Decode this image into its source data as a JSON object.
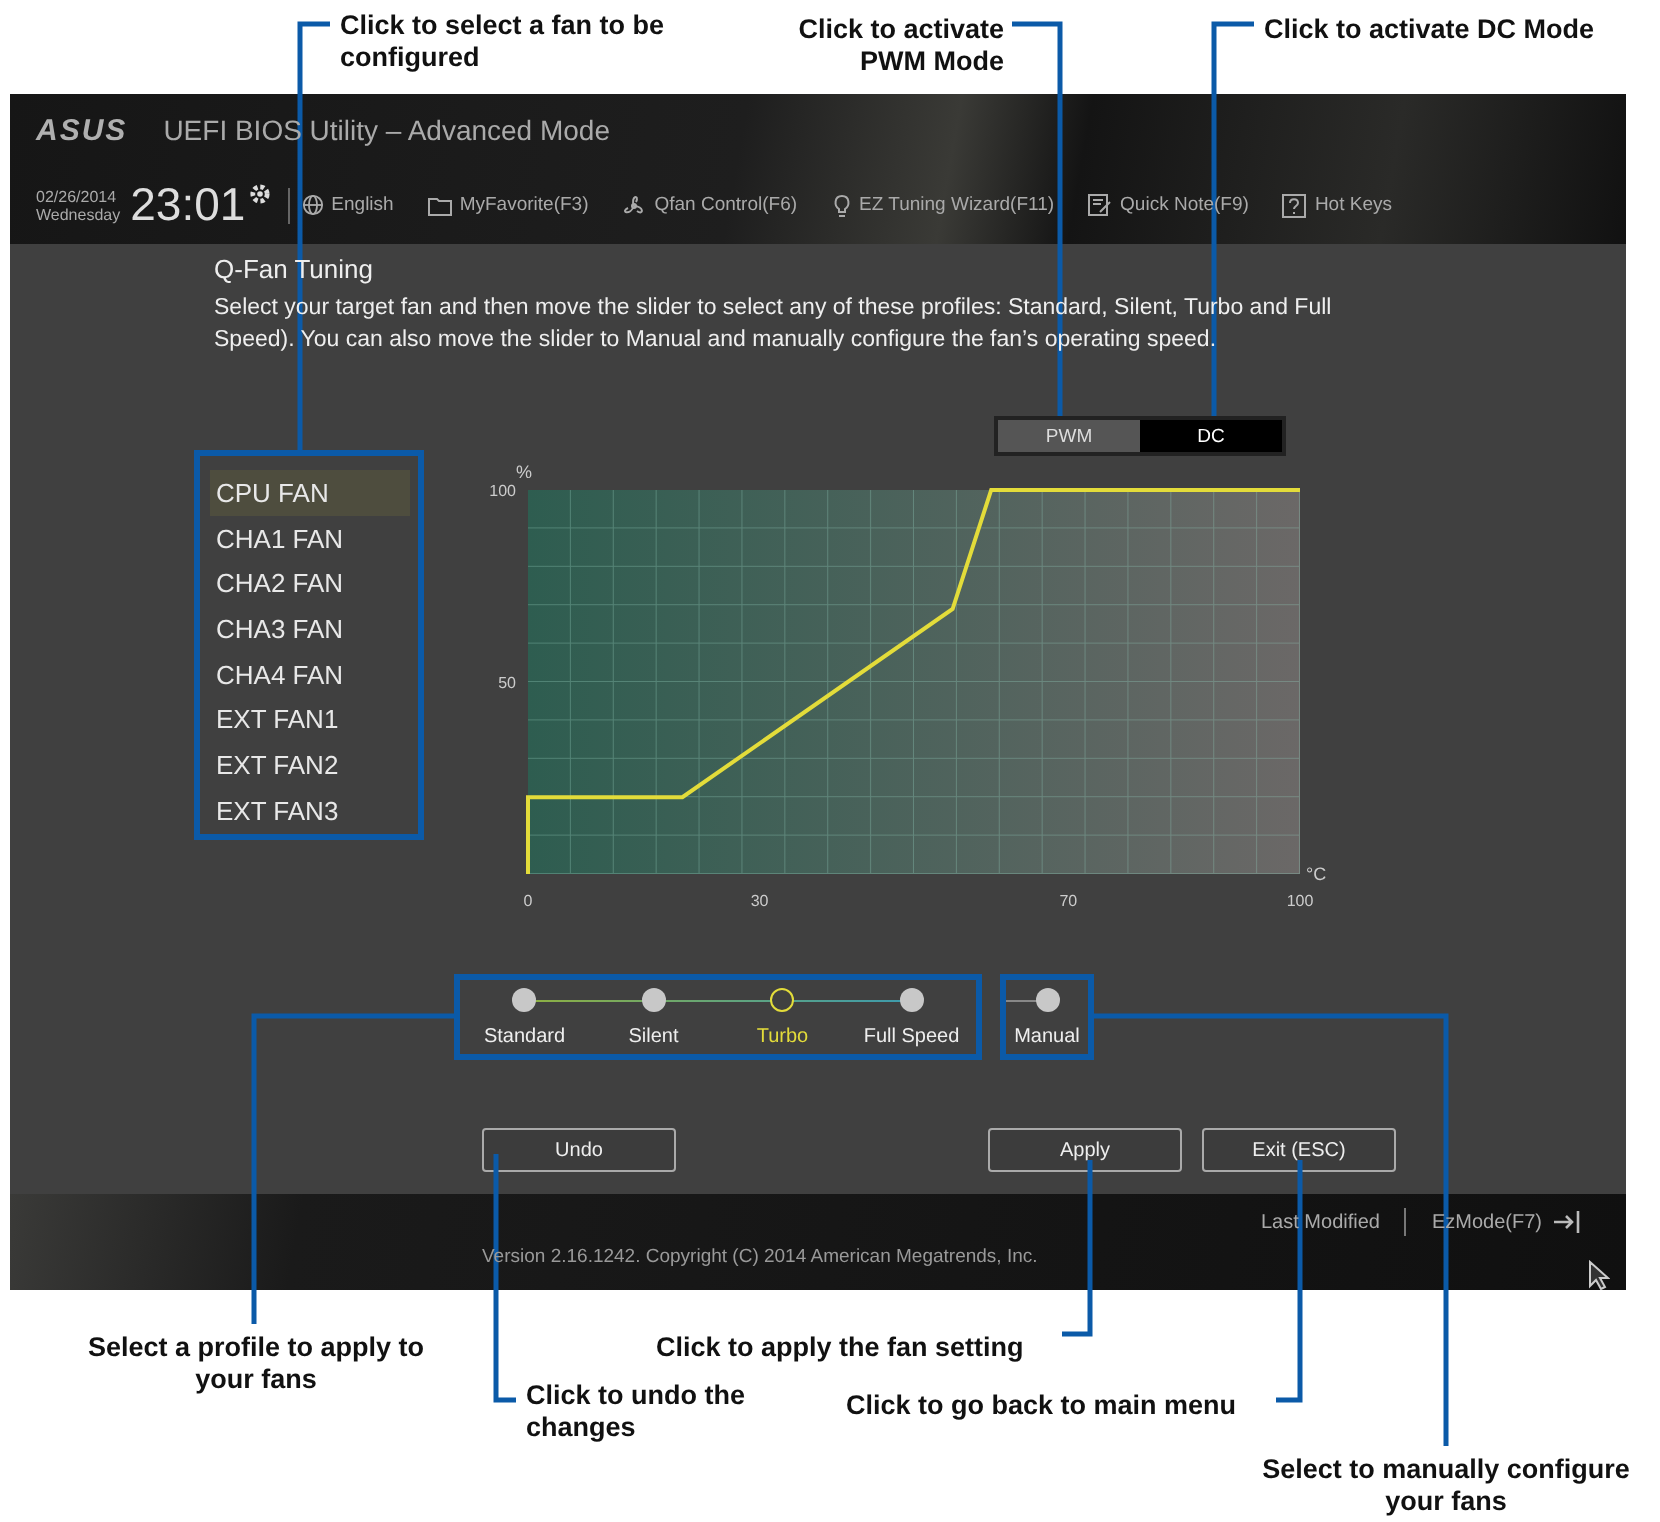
{
  "header": {
    "logo": "ASUS",
    "title": "UEFI BIOS Utility – Advanced Mode",
    "date": "02/26/2014",
    "weekday": "Wednesday",
    "time": "23:01",
    "menu": [
      {
        "kind": "globe",
        "label": "English"
      },
      {
        "kind": "favorite",
        "label": "MyFavorite(F3)"
      },
      {
        "kind": "fan",
        "label": "Qfan Control(F6)"
      },
      {
        "kind": "bulb",
        "label": "EZ Tuning Wizard(F11)"
      },
      {
        "kind": "note",
        "label": "Quick Note(F9)"
      },
      {
        "kind": "help",
        "label": "Hot Keys"
      }
    ]
  },
  "page": {
    "title": "Q-Fan Tuning",
    "description": "Select your target fan and then move the slider to select any of these profiles: Standard, Silent, Turbo and Full Speed). You can also move the slider to Manual and manually configure the fan’s operating speed."
  },
  "mode_toggle": [
    {
      "label": "PWM",
      "selected": false
    },
    {
      "label": "DC",
      "selected": true
    }
  ],
  "fans": [
    {
      "label": "CPU FAN",
      "selected": true
    },
    {
      "label": "CHA1 FAN",
      "selected": false
    },
    {
      "label": "CHA2 FAN",
      "selected": false
    },
    {
      "label": "CHA3 FAN",
      "selected": false
    },
    {
      "label": "CHA4 FAN",
      "selected": false
    },
    {
      "label": "EXT FAN1",
      "selected": false
    },
    {
      "label": "EXT FAN2",
      "selected": false
    },
    {
      "label": "EXT FAN3",
      "selected": false
    }
  ],
  "fan_chart": {
    "chart_data": {
      "type": "line",
      "xlabel": "°C",
      "ylabel": "%",
      "x": [
        0,
        0,
        20,
        55,
        60,
        100
      ],
      "series": [
        {
          "color": "#e3dc3a",
          "values": [
            0,
            20,
            20,
            69,
            100,
            100
          ]
        }
      ],
      "xlim": [
        0,
        100
      ],
      "ylim": [
        0,
        100
      ],
      "xticks": [
        0,
        30,
        70,
        100
      ],
      "yticks": [
        50,
        100
      ]
    }
  },
  "profiles": [
    {
      "label": "Standard",
      "selected": false
    },
    {
      "label": "Silent",
      "selected": false
    },
    {
      "label": "Turbo",
      "selected": true
    },
    {
      "label": "Full Speed",
      "selected": false
    }
  ],
  "manual": {
    "label": "Manual",
    "selected": false
  },
  "buttons": [
    {
      "label": "Undo"
    },
    {
      "label": "Apply"
    },
    {
      "label": "Exit (ESC)"
    }
  ],
  "footer": {
    "last_modified": "Last Modified",
    "ez_mode": "EzMode(F7)",
    "version": "Version 2.16.1242. Copyright (C) 2014 American Megatrends, Inc."
  },
  "callouts": [
    {
      "text": "Click to select a fan to be configured"
    },
    {
      "text": "Click to activate PWM Mode"
    },
    {
      "text": "Click to activate DC Mode"
    },
    {
      "text": "Select a profile to apply to your fans"
    },
    {
      "text": "Click to undo the changes"
    },
    {
      "text": "Click to apply the fan setting"
    },
    {
      "text": "Click to go back to main menu"
    },
    {
      "text": "Select to manually configure your fans"
    }
  ]
}
